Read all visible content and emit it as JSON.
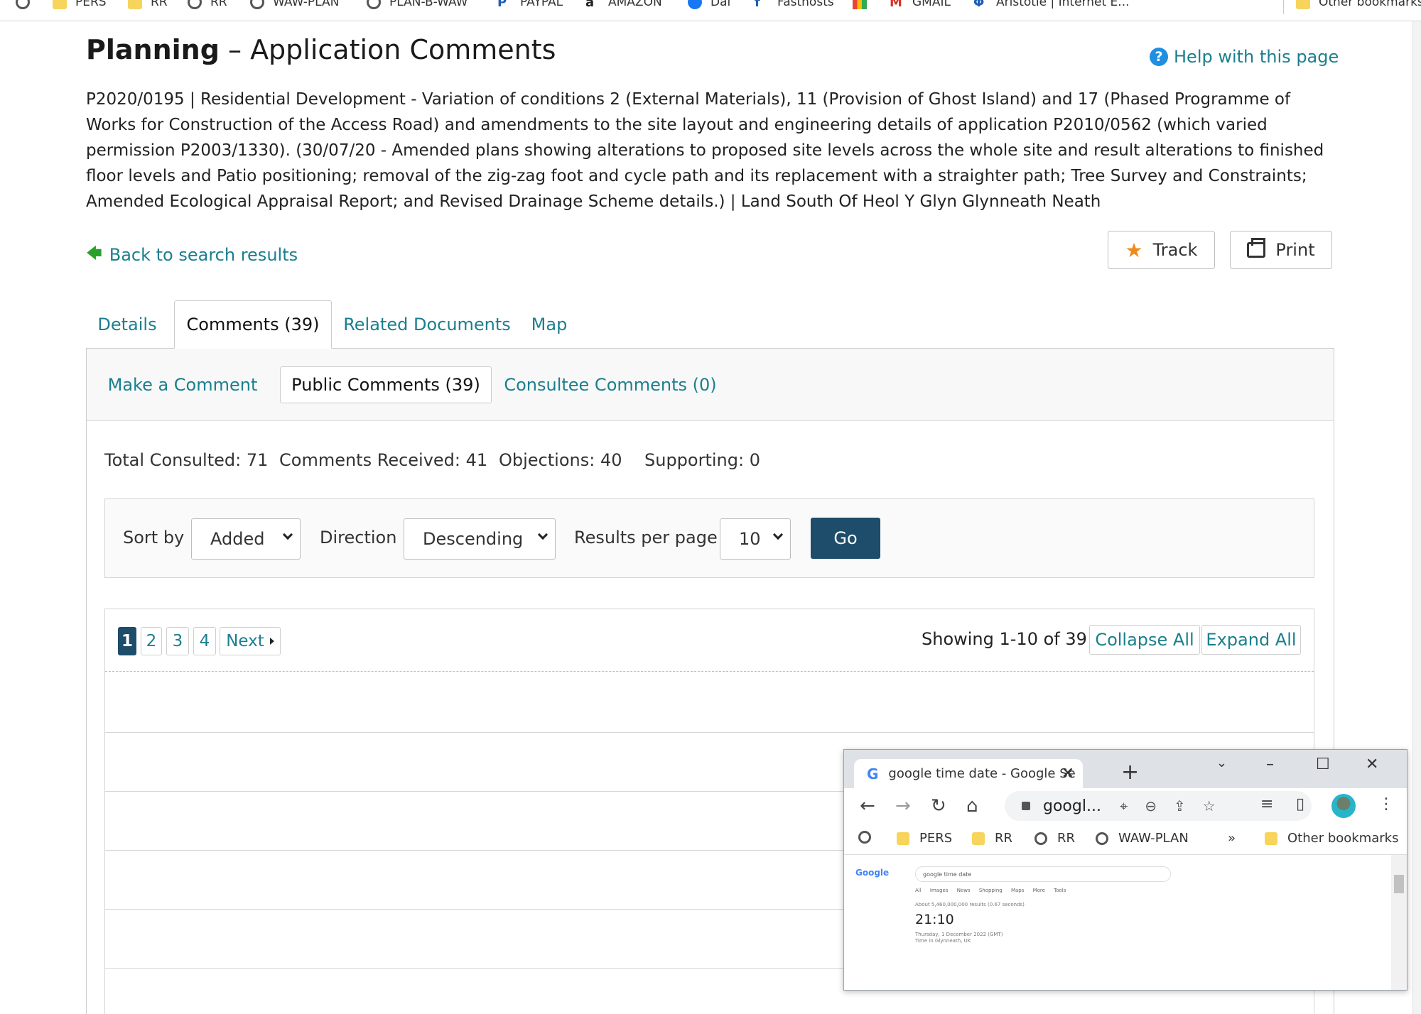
{
  "bookmarks_bar": {
    "items": [
      {
        "label": "PERS",
        "icon": "folder-icon"
      },
      {
        "label": "RR",
        "icon": "folder-icon"
      },
      {
        "label": "RR",
        "icon": "globe-icon"
      },
      {
        "label": "WAW-PLAN",
        "icon": "globe-icon"
      },
      {
        "label": "PLAN-B-WAW",
        "icon": "globe-icon"
      },
      {
        "label": "PAYPAL",
        "icon": "paypal-icon"
      },
      {
        "label": "AMAZON",
        "icon": "amazon-icon"
      },
      {
        "label": "Dai",
        "icon": "facebook-icon"
      },
      {
        "label": "Fasthosts",
        "icon": "fasthosts-icon"
      },
      {
        "label": "",
        "icon": "google-slides-icon"
      },
      {
        "label": "GMAIL",
        "icon": "gmail-icon"
      },
      {
        "label": "Aristotle | Internet E...",
        "icon": "aristotle-icon"
      }
    ],
    "other_bookmarks": "Other bookmarks"
  },
  "header": {
    "title_bold": "Planning",
    "title_rest": " – Application Comments",
    "help_link": "Help with this page"
  },
  "application": {
    "description": "P2020/0195 | Residential Development - Variation of conditions 2 (External Materials), 11 (Provision of Ghost Island) and 17 (Phased Programme of Works for Construction of the Access Road) and amendments to the site layout and engineering details of application P2010/0562 (which varied permission P2003/1330). (30/07/20 - Amended plans showing alterations to proposed site levels across the whole site and result alterations to finished floor levels and Patio positioning; removal of the zig-zag foot and cycle path and its replacement with a straighter path; Tree Survey and Constraints; Amended Ecological Appraisal Report; and Revised Drainage Scheme details.) | Land South Of Heol Y Glyn Glynneath Neath"
  },
  "actions": {
    "back": "Back to search results",
    "track": "Track",
    "print": "Print"
  },
  "tabs": [
    {
      "label": "Details"
    },
    {
      "label": "Comments (39)",
      "active": true
    },
    {
      "label": "Related Documents"
    },
    {
      "label": "Map"
    }
  ],
  "subtabs": [
    {
      "label": "Make a Comment"
    },
    {
      "label": "Public Comments (39)",
      "active": true
    },
    {
      "label": "Consultee Comments (0)"
    }
  ],
  "stats": {
    "total_consulted": "Total Consulted: 71",
    "comments_received": "Comments Received: 41",
    "objections": "Objections: 40",
    "supporting": "Supporting: 0"
  },
  "sort": {
    "sort_by_label": "Sort by",
    "sort_by_value": "Added",
    "direction_label": "Direction",
    "direction_value": "Descending",
    "per_page_label": "Results per page",
    "per_page_value": "10",
    "go": "Go"
  },
  "pagination": {
    "pages": [
      "1",
      "2",
      "3",
      "4"
    ],
    "current": "1",
    "next": "Next",
    "showing": "Showing 1-10 of 39",
    "collapse_all": "Collapse All",
    "expand_all": "Expand All"
  },
  "popup_window": {
    "tab_title": "google time date - Google Se",
    "url": "googl...",
    "bookmarks": [
      {
        "label": "PERS",
        "icon": "folder-icon"
      },
      {
        "label": "RR",
        "icon": "folder-icon"
      },
      {
        "label": "RR",
        "icon": "globe-icon"
      },
      {
        "label": "WAW-PLAN",
        "icon": "globe-icon"
      }
    ],
    "overflow": "»",
    "other_bookmarks": "Other bookmarks",
    "content": {
      "search_query": "google time date",
      "tabs": "All Images News Shopping Maps More Tools",
      "results_info": "About 5,460,000,000 results (0.67 seconds)",
      "time": "21:10",
      "date_line": "Thursday, 1 December 2022 (GMT)",
      "location_line": "Time in Glynneath, UK"
    }
  },
  "colors": {
    "link": "#1a7f8e",
    "primary_button": "#1d4d6a",
    "star": "#f08a1d",
    "back_arrow": "#2aa02a"
  }
}
